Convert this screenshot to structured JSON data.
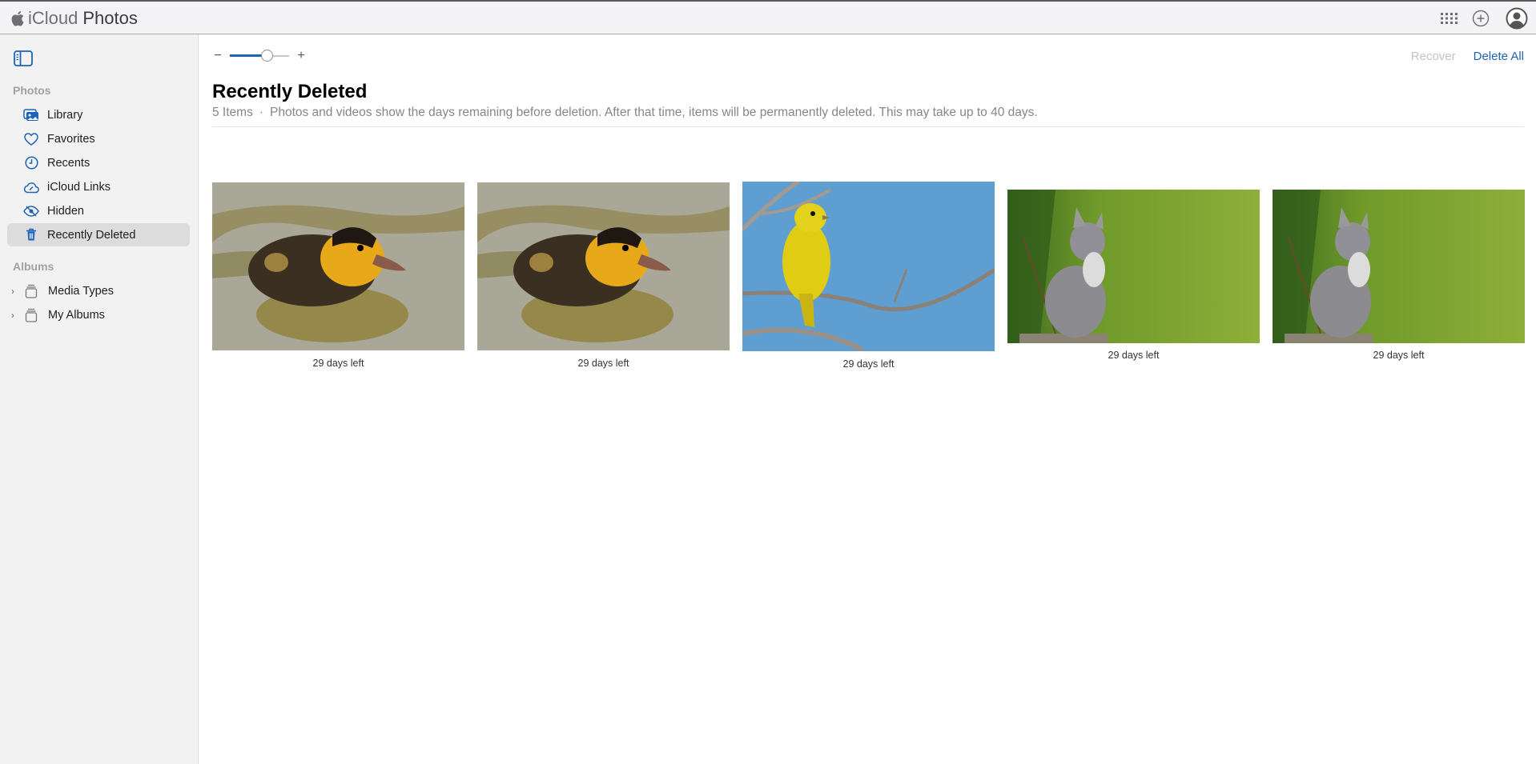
{
  "app": {
    "title_prefix": "iCloud",
    "title": "Photos"
  },
  "topbar": {
    "icons": [
      "apps-grid-icon",
      "add-circle-icon",
      "account-icon"
    ]
  },
  "sidebar": {
    "toggle_icon": "sidebar-toggle-icon",
    "photos_section": "Photos",
    "items": [
      {
        "label": "Library",
        "icon": "library-icon",
        "active": false
      },
      {
        "label": "Favorites",
        "icon": "heart-icon",
        "active": false
      },
      {
        "label": "Recents",
        "icon": "clock-icon",
        "active": false
      },
      {
        "label": "iCloud Links",
        "icon": "cloud-link-icon",
        "active": false
      },
      {
        "label": "Hidden",
        "icon": "eye-slash-icon",
        "active": false
      },
      {
        "label": "Recently Deleted",
        "icon": "trash-icon",
        "active": true
      }
    ],
    "albums_section": "Albums",
    "albums": [
      {
        "label": "Media Types",
        "icon": "album-stack-icon"
      },
      {
        "label": "My Albums",
        "icon": "album-stack-icon"
      }
    ]
  },
  "toolbar": {
    "zoom_out_label": "−",
    "zoom_in_label": "+",
    "zoom_level_percent": 62,
    "recover_label": "Recover",
    "delete_all_label": "Delete All"
  },
  "main": {
    "title": "Recently Deleted",
    "item_count": "5 Items",
    "separator": "·",
    "description": "Photos and videos show the days remaining before deletion. After that time, items will be permanently deleted. This may take up to 40 days."
  },
  "photos": [
    {
      "subject": "duckling",
      "caption": "29 days left"
    },
    {
      "subject": "duckling",
      "caption": "29 days left"
    },
    {
      "subject": "yellow bird on branch",
      "caption": "29 days left"
    },
    {
      "subject": "kitten",
      "caption": "29 days left"
    },
    {
      "subject": "kitten",
      "caption": "29 days left"
    }
  ],
  "colors": {
    "accent": "#1d63b8",
    "sidebar_bg": "#f2f2f2",
    "active_item_bg": "#dcdcdc",
    "disabled_text": "#c4c4c6"
  }
}
